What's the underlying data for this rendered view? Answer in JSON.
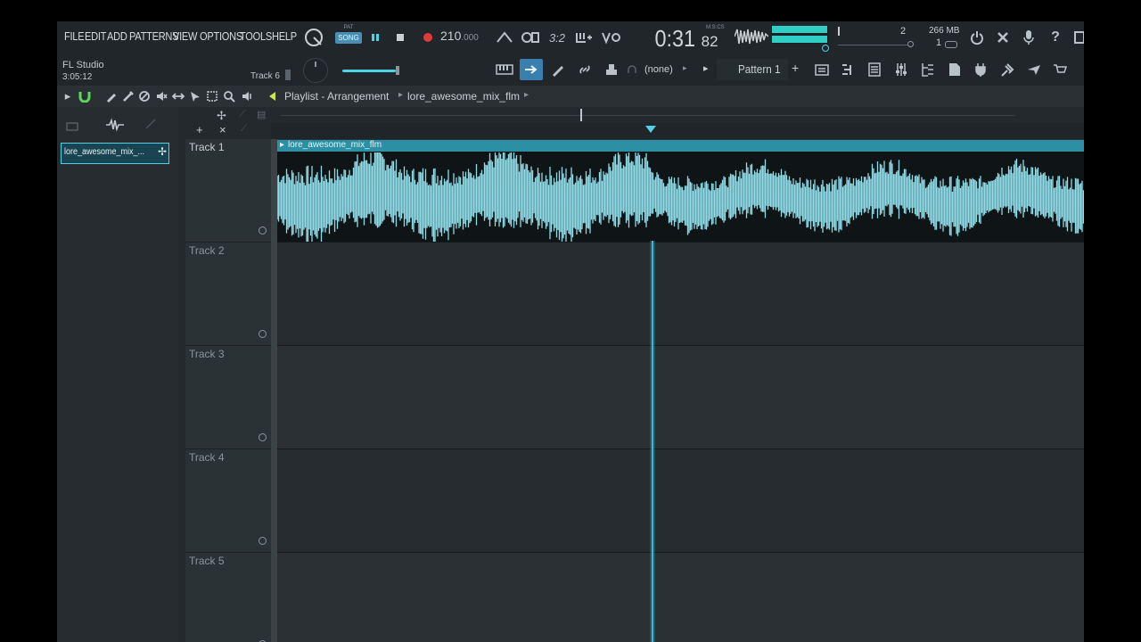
{
  "menu": [
    "FILE",
    "EDIT",
    "ADD",
    "PATTERNS",
    "VIEW",
    "OPTIONS",
    "TOOLS",
    "HELP"
  ],
  "transport": {
    "pat_label": "PAT",
    "song_label": "SONG",
    "tempo": "210",
    "tempo_decimal": ".000",
    "time_main": "0:31",
    "time_sub": "82",
    "time_unit": "M:S:CS",
    "snap_display": "3:2"
  },
  "info": {
    "app_name": "FL Studio",
    "elapsed": "3:05:12",
    "track_hint": "Track 6",
    "cpu_value": "2",
    "memory": "266 MB",
    "polyphony": "1"
  },
  "pattern": {
    "channel_none": "(none)",
    "pattern_name": "Pattern 1"
  },
  "playlist": {
    "breadcrumb_root": "Playlist - Arrangement",
    "breadcrumb_file": "lore_awesome_mix_flm"
  },
  "browser": {
    "selected_clip": "lore_awesome_mix_..."
  },
  "tracks": [
    {
      "name": "Track 1"
    },
    {
      "name": "Track 2"
    },
    {
      "name": "Track 3"
    },
    {
      "name": "Track 4"
    },
    {
      "name": "Track 5"
    }
  ],
  "clip": {
    "title": "lore_awesome_mix_flm",
    "color": "#8fdce8"
  },
  "colors": {
    "accent": "#4fd1e6",
    "playhead": "#39b9d6",
    "meter": "#2fcfc5",
    "record": "#e23a3a",
    "magnet": "#5cd65c"
  }
}
